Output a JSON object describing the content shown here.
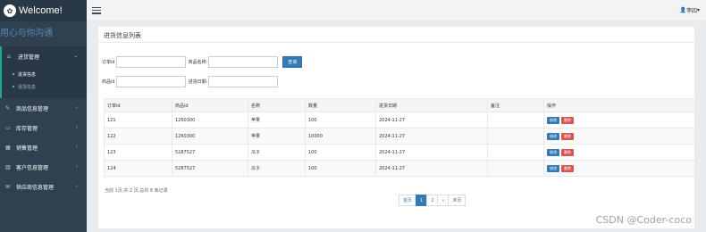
{
  "brand": {
    "title": "Welcome!",
    "logo_icon": "paw-icon"
  },
  "sidebar": {
    "slogan": "用心与你沟通",
    "items": [
      {
        "label": "进货管理",
        "icon": "home-icon",
        "expanded": true,
        "children": [
          {
            "label": "进货信息",
            "current": true
          },
          {
            "label": "退货信息",
            "current": false
          }
        ]
      },
      {
        "label": "商品信息管理",
        "icon": "edit-icon"
      },
      {
        "label": "库存管理",
        "icon": "desktop-icon"
      },
      {
        "label": "销售管理",
        "icon": "table-icon"
      },
      {
        "label": "客户信息管理",
        "icon": "chart-icon"
      },
      {
        "label": "供应商信息管理",
        "icon": "envelope-icon"
      }
    ]
  },
  "topbar": {
    "user_label": "李四"
  },
  "panel": {
    "title": "进货信息列表",
    "form": {
      "order_id_label": "订单id",
      "goods_name_label": "商品名称:",
      "search_button": "查询",
      "goods_id_label": "商品id",
      "stock_date_label": "进货日期:"
    },
    "table": {
      "headers": [
        "订单id",
        "商品id",
        "名称",
        "数量",
        "进货日期",
        "备注",
        "操作"
      ],
      "rows": [
        [
          "121",
          "1260300",
          "苹果",
          "100",
          "2024-11-27",
          ""
        ],
        [
          "122",
          "1260300",
          "苹果",
          "10000",
          "2024-11-27",
          ""
        ],
        [
          "123",
          "5287527",
          "瓜子",
          "100",
          "2024-11-27",
          ""
        ],
        [
          "124",
          "5287527",
          "瓜子",
          "100",
          "2024-11-27",
          ""
        ]
      ],
      "edit_label": "修改",
      "delete_label": "删除"
    },
    "page_info": "当前 1页,共 2 页,总共 8 条记录",
    "pager": [
      "首页",
      "1",
      "2",
      "»",
      "末页"
    ],
    "pager_active": 1
  },
  "watermark": "CSDN @Coder-coco"
}
